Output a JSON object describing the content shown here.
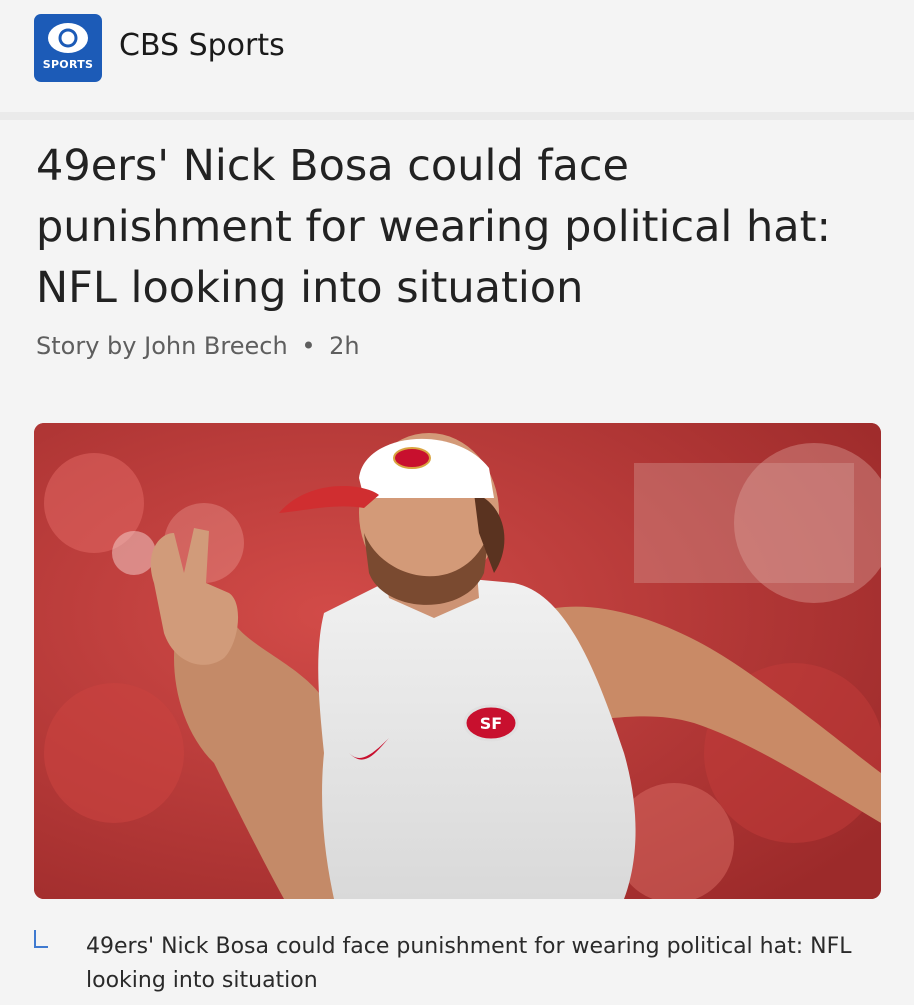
{
  "publisher": {
    "logo_text": "SPORTS",
    "logo_icon": "cbs-eye-icon",
    "name": "CBS Sports",
    "brand_color": "#1c5bb7"
  },
  "article": {
    "headline": "49ers' Nick Bosa could face punishment for wearing political hat: NFL looking into situation",
    "byline_prefix": "Story by",
    "author": "John Breech",
    "separator": "•",
    "time": "2h",
    "caption": "49ers' Nick Bosa could face punishment for wearing political hat: NFL looking into situation"
  },
  "colors": {
    "accent_blue": "#3f7ad0",
    "stadium_red": "#b83a38"
  }
}
